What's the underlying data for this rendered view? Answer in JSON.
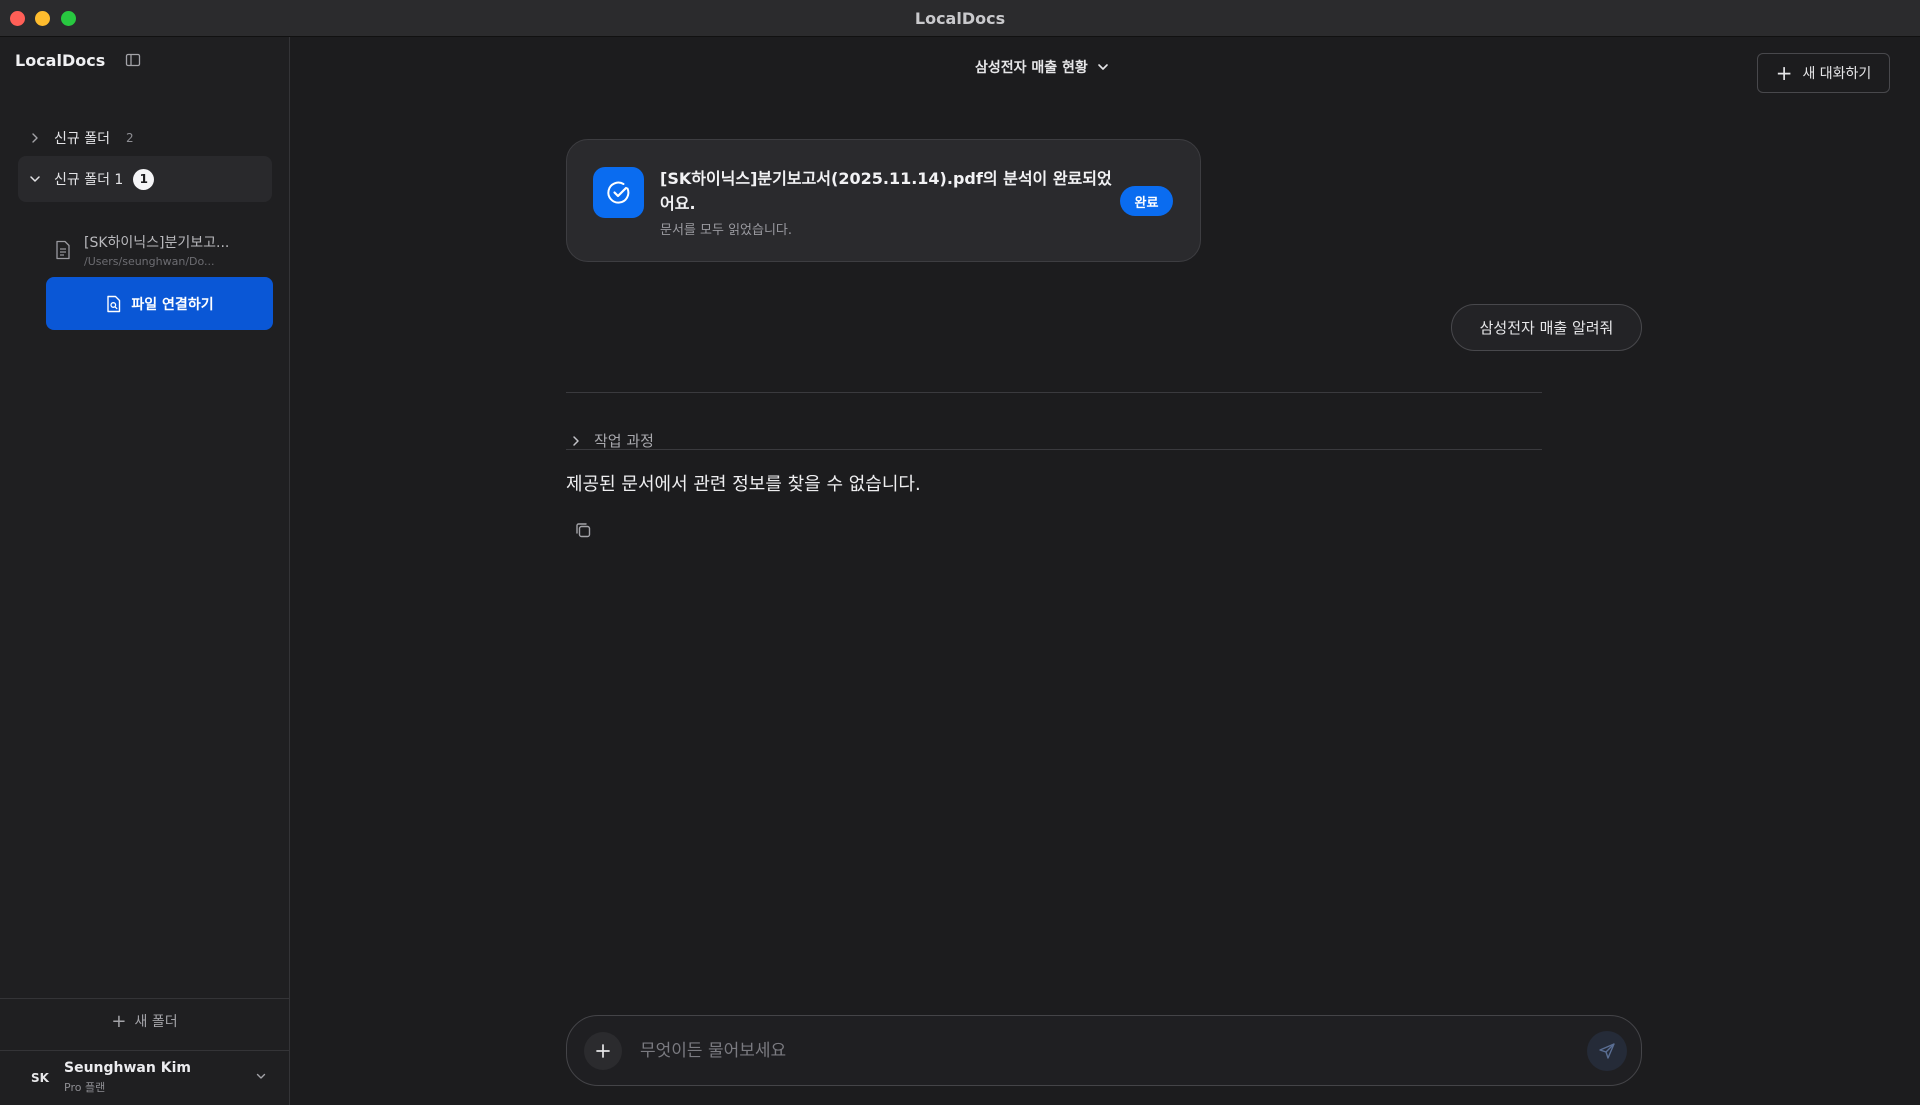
{
  "window": {
    "title": "LocalDocs"
  },
  "sidebar": {
    "brand": "LocalDocs",
    "folders": [
      {
        "name": "신규 폴더",
        "count": "2",
        "expanded": false
      },
      {
        "name": "신규 폴더 1",
        "count": "1",
        "expanded": true
      }
    ],
    "file": {
      "name": "[SK하이닉스]분기보고...",
      "path": "/Users/seunghwan/Do..."
    },
    "connect_label": "파일 연결하기",
    "new_folder_label": "새 폴더",
    "user": {
      "initials": "SK",
      "name": "Seunghwan Kim",
      "plan": "Pro 플랜"
    }
  },
  "header": {
    "conversation_title": "삼성전자 매출 현황",
    "new_chat_label": "새 대화하기"
  },
  "status_card": {
    "title": "[SK하이닉스]분기보고서(2025.11.14).pdf의 분석이 완료되었어요.",
    "subtitle": "문서를 모두 읽었습니다.",
    "badge": "완료"
  },
  "messages": {
    "user": "삼성전자 매출 알려줘",
    "process_label": "작업 과정",
    "answer": "제공된 문서에서 관련 정보를 찾을 수 없습니다."
  },
  "composer": {
    "placeholder": "무엇이든 물어보세요"
  },
  "colors": {
    "accent": "#0a6cf0",
    "connect_button": "#0a57d6",
    "background": "#1c1c1e"
  }
}
